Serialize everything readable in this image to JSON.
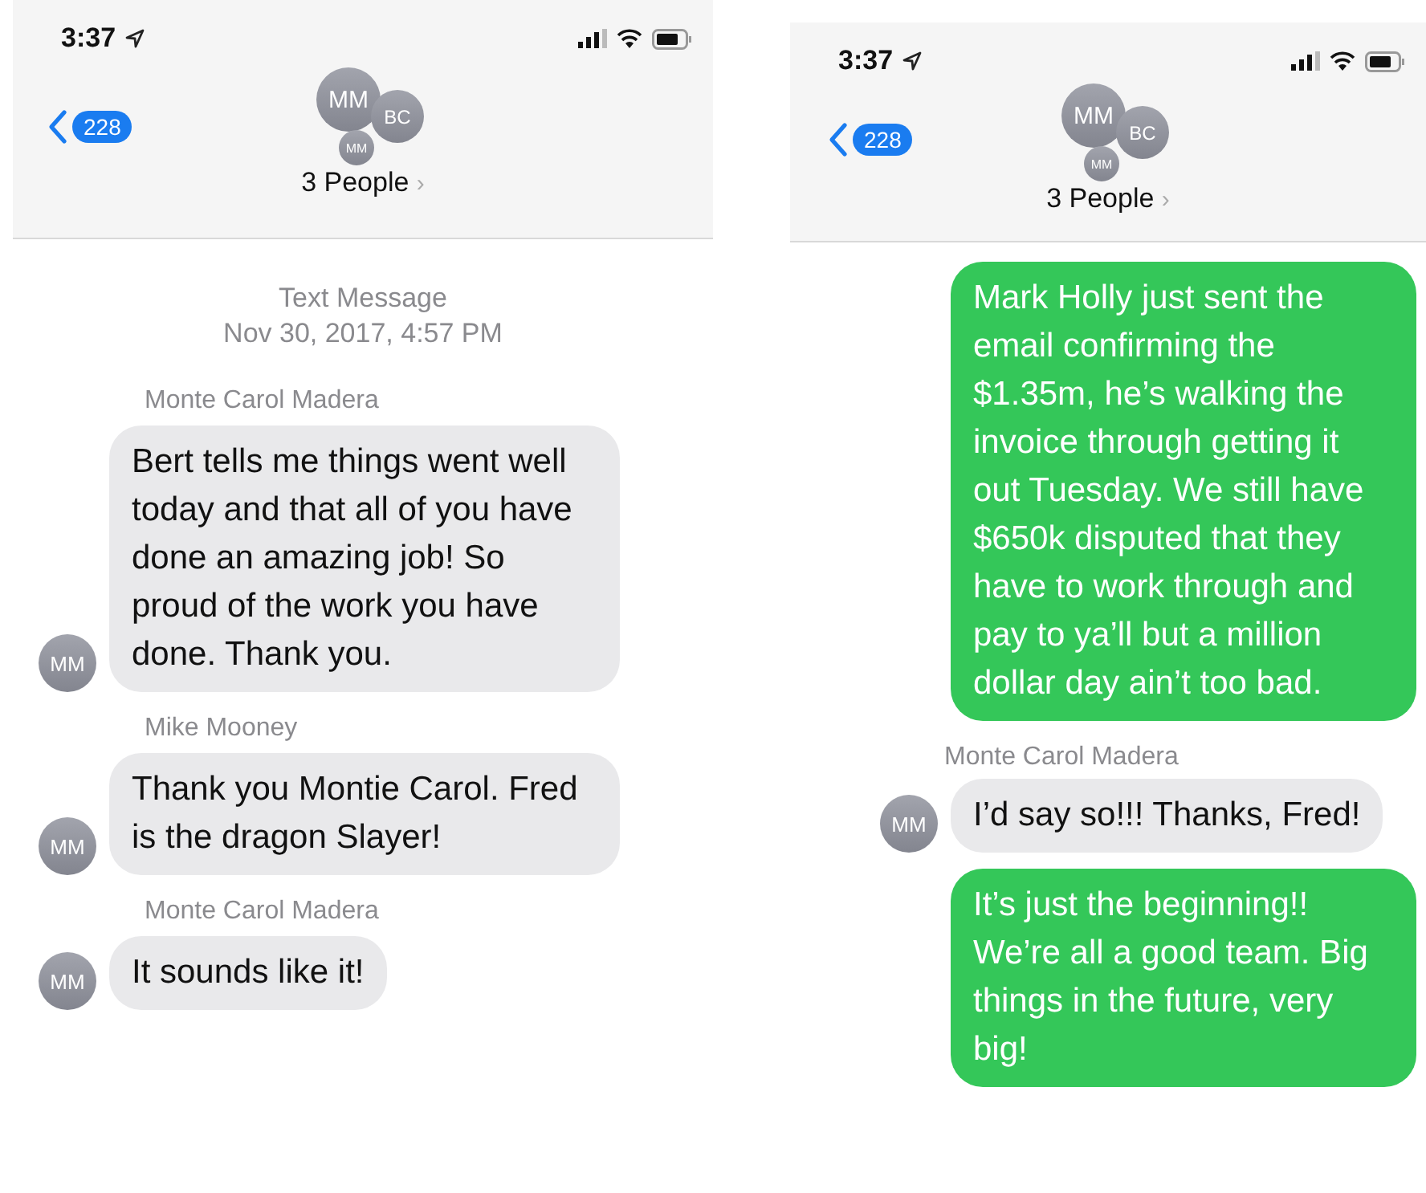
{
  "screens": [
    {
      "status_time": "3:37",
      "back_count": "228",
      "avatars": [
        "MM",
        "BC",
        "MM"
      ],
      "title": "3 People",
      "title_chevron": "›",
      "messages": [
        {
          "kind": "timestamp",
          "label": "Text Message",
          "time": "Nov 30, 2017, 4:57 PM"
        },
        {
          "kind": "incoming",
          "sender": "Monte Carol Madera",
          "text": "Bert tells me things went well today and that all of you have done an amazing job!  So proud of the work you have done. Thank you.",
          "avatar": "MM"
        },
        {
          "kind": "incoming",
          "sender": "Mike Mooney",
          "text": "Thank you Montie Carol. Fred is the dragon Slayer!",
          "avatar": "MM"
        },
        {
          "kind": "incoming",
          "sender": "Monte Carol Madera",
          "text": "It sounds like it!",
          "avatar": "MM"
        }
      ]
    },
    {
      "status_time": "3:37",
      "back_count": "228",
      "avatars": [
        "MM",
        "BC",
        "MM"
      ],
      "title": "3 People",
      "title_chevron": "›",
      "messages": [
        {
          "kind": "outgoing",
          "text": "Mark Holly just sent the email confirming the $1.35m, he’s walking the invoice through getting it out Tuesday. We still have $650k disputed that they have to work through and pay to ya’ll but a million dollar day ain’t too bad."
        },
        {
          "kind": "incoming",
          "sender": "Monte Carol Madera",
          "text": "I’d say so!!!  Thanks, Fred!",
          "avatar": "MM"
        },
        {
          "kind": "outgoing",
          "text": "It’s just the beginning!! We’re all a good team. Big things in the future, very big!"
        }
      ]
    }
  ]
}
